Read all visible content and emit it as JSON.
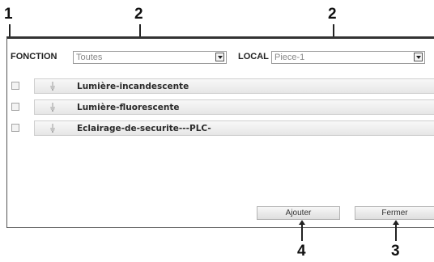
{
  "callouts": {
    "c1": "1",
    "c2a": "2",
    "c2b": "2",
    "c3": "3",
    "c4": "4"
  },
  "filters": {
    "fonction_label": "FONCTION",
    "fonction_value": "Toutes",
    "local_label": "LOCAL",
    "local_value": "Piece-1"
  },
  "items": [
    {
      "label": "Lumière-incandescente",
      "checked": false,
      "icon": "bulb-icon"
    },
    {
      "label": "Lumière-fluorescente",
      "checked": false,
      "icon": "bulb-icon"
    },
    {
      "label": "Eclairage-de-securite---PLC-",
      "checked": false,
      "icon": "bulb-icon"
    }
  ],
  "buttons": {
    "add_label": "Ajouter",
    "close_label": "Fermer"
  }
}
